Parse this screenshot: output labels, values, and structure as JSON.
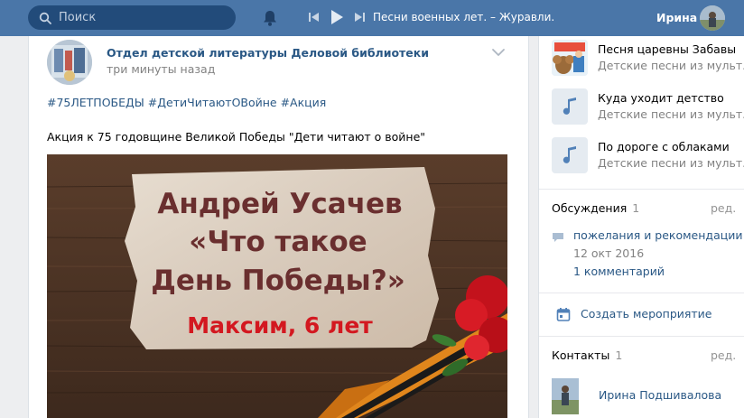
{
  "header": {
    "search_placeholder": "Поиск",
    "track": "Песни военных лет. – Журавли. ...",
    "user_name": "Ирина"
  },
  "post": {
    "author": "Отдел детской литературы Деловой библиотеки",
    "time": "три минуты назад",
    "hashtags": "#75ЛЕТПОБЕДЫ #ДетиЧитаютОВойне #Акция",
    "text": "Акция к 75 годовщине Великой Победы \"Дети читают о войне\"",
    "image": {
      "line1": "Андрей Усачев",
      "line2": "«Что такое",
      "line3": "День Победы?»",
      "line4": "Максим, 6 лет"
    }
  },
  "audio": [
    {
      "title": "Песня царевны Забавы",
      "subtitle": "Детские песни из мульт..."
    },
    {
      "title": "Куда уходит детство",
      "subtitle": "Детские песни из мульт..."
    },
    {
      "title": "По дороге с облаками",
      "subtitle": "Детские песни из мульт..."
    }
  ],
  "discussions": {
    "title": "Обсуждения",
    "count": "1",
    "edit": "ред.",
    "topic": {
      "title": "пожелания и рекомендации",
      "date": "12 окт 2016",
      "comments": "1 комментарий"
    }
  },
  "create_event": "Создать мероприятие",
  "contacts": {
    "title": "Контакты",
    "count": "1",
    "edit": "ред.",
    "person": "Ирина Подшивалова"
  },
  "colors": {
    "header_bg": "#4a76a8",
    "link": "#2a5885",
    "muted": "#828282",
    "page_bg": "#edeef0"
  }
}
